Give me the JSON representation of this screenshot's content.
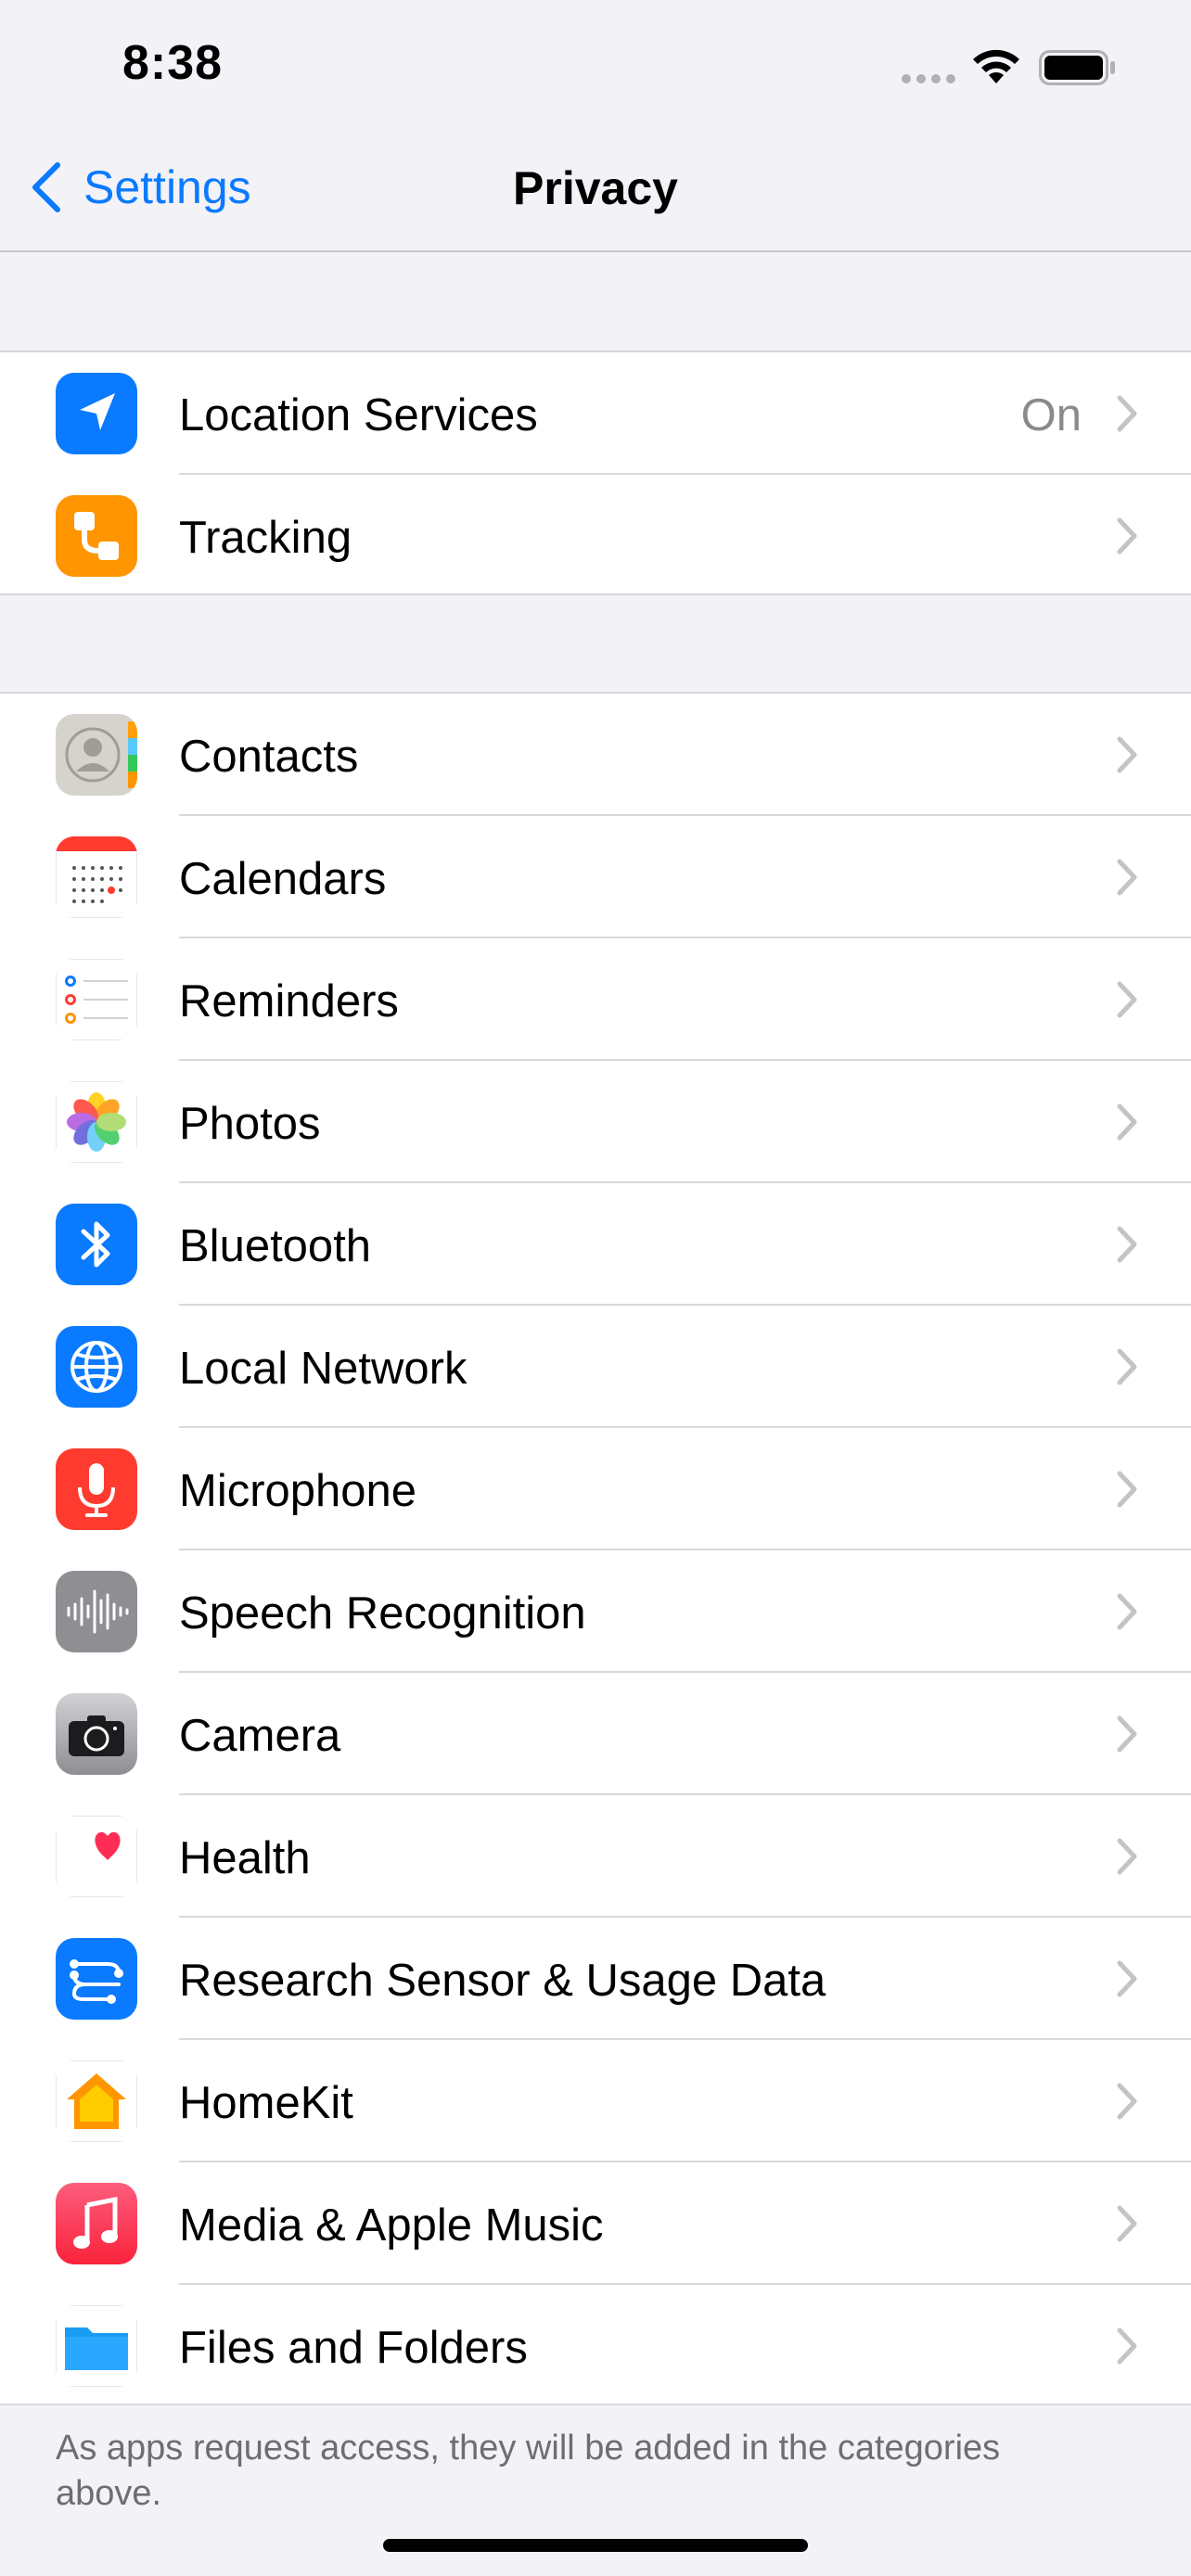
{
  "status_bar": {
    "time": "8:38"
  },
  "nav": {
    "back_label": "Settings",
    "title": "Privacy"
  },
  "group_1": [
    {
      "label": "Location Services",
      "value": "On",
      "icon": "location-arrow-icon",
      "color": "#0a7aff"
    },
    {
      "label": "Tracking",
      "value": "",
      "icon": "tracking-icon",
      "color": "#ff9500"
    }
  ],
  "group_2": [
    {
      "label": "Contacts",
      "icon": "contacts-icon"
    },
    {
      "label": "Calendars",
      "icon": "calendar-icon"
    },
    {
      "label": "Reminders",
      "icon": "reminders-icon"
    },
    {
      "label": "Photos",
      "icon": "photos-icon"
    },
    {
      "label": "Bluetooth",
      "icon": "bluetooth-icon",
      "color": "#0a7aff"
    },
    {
      "label": "Local Network",
      "icon": "globe-icon",
      "color": "#0a7aff"
    },
    {
      "label": "Microphone",
      "icon": "microphone-icon",
      "color": "#ff3b30"
    },
    {
      "label": "Speech Recognition",
      "icon": "waveform-icon",
      "color": "#8e8e93"
    },
    {
      "label": "Camera",
      "icon": "camera-icon",
      "color": "#8e8e93"
    },
    {
      "label": "Health",
      "icon": "heart-icon",
      "color": "#ff2d55"
    },
    {
      "label": "Research Sensor & Usage Data",
      "icon": "research-icon",
      "color": "#0a7aff"
    },
    {
      "label": "HomeKit",
      "icon": "home-icon",
      "color": "#ff9500"
    },
    {
      "label": "Media & Apple Music",
      "icon": "music-note-icon",
      "color": "#fc3c44"
    },
    {
      "label": "Files and Folders",
      "icon": "folder-icon",
      "color": "#1a9bf2"
    }
  ],
  "footer_note": "As apps request access, they will be added in the categories above.",
  "colors": {
    "accent": "#0a7aff",
    "background": "#f2f2f7",
    "secondary_text": "#8a8a8e"
  }
}
